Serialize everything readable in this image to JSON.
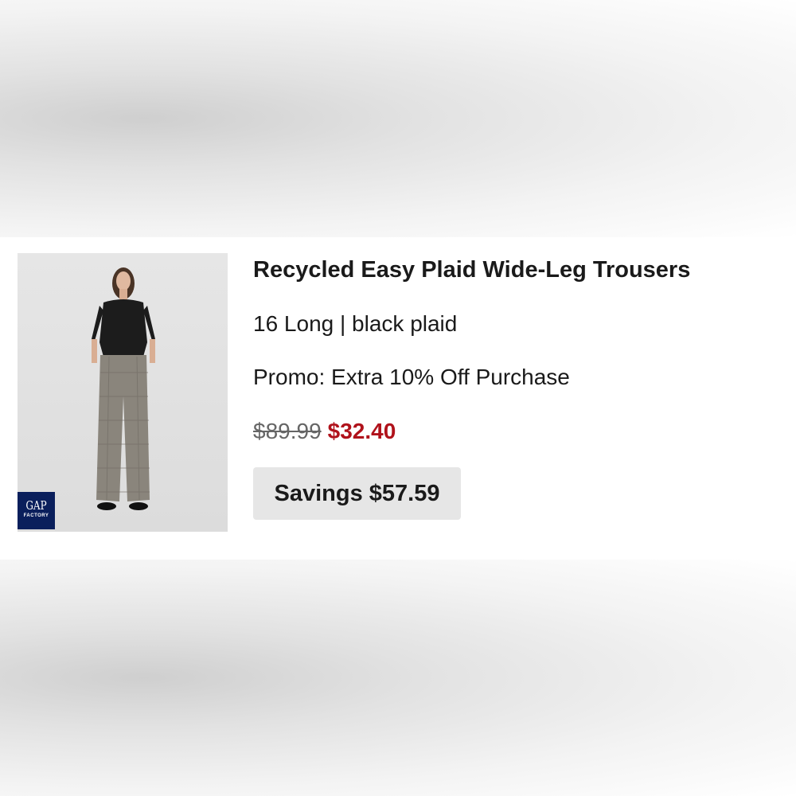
{
  "product": {
    "title": "Recycled Easy Plaid Wide-Leg Trousers",
    "variant": "16 Long | black plaid",
    "promo": "Promo: Extra 10% Off Purchase",
    "price_original": "$89.99",
    "price_sale": "$32.40",
    "savings": "Savings $57.59",
    "image_icon": "model-wearing-trousers-image"
  },
  "brand": {
    "logo_word": "GAP",
    "logo_sub": "FACTORY",
    "color": "#0a1f5c"
  },
  "colors": {
    "sale_price": "#b0121b",
    "badge_background": "#e6e6e6"
  }
}
